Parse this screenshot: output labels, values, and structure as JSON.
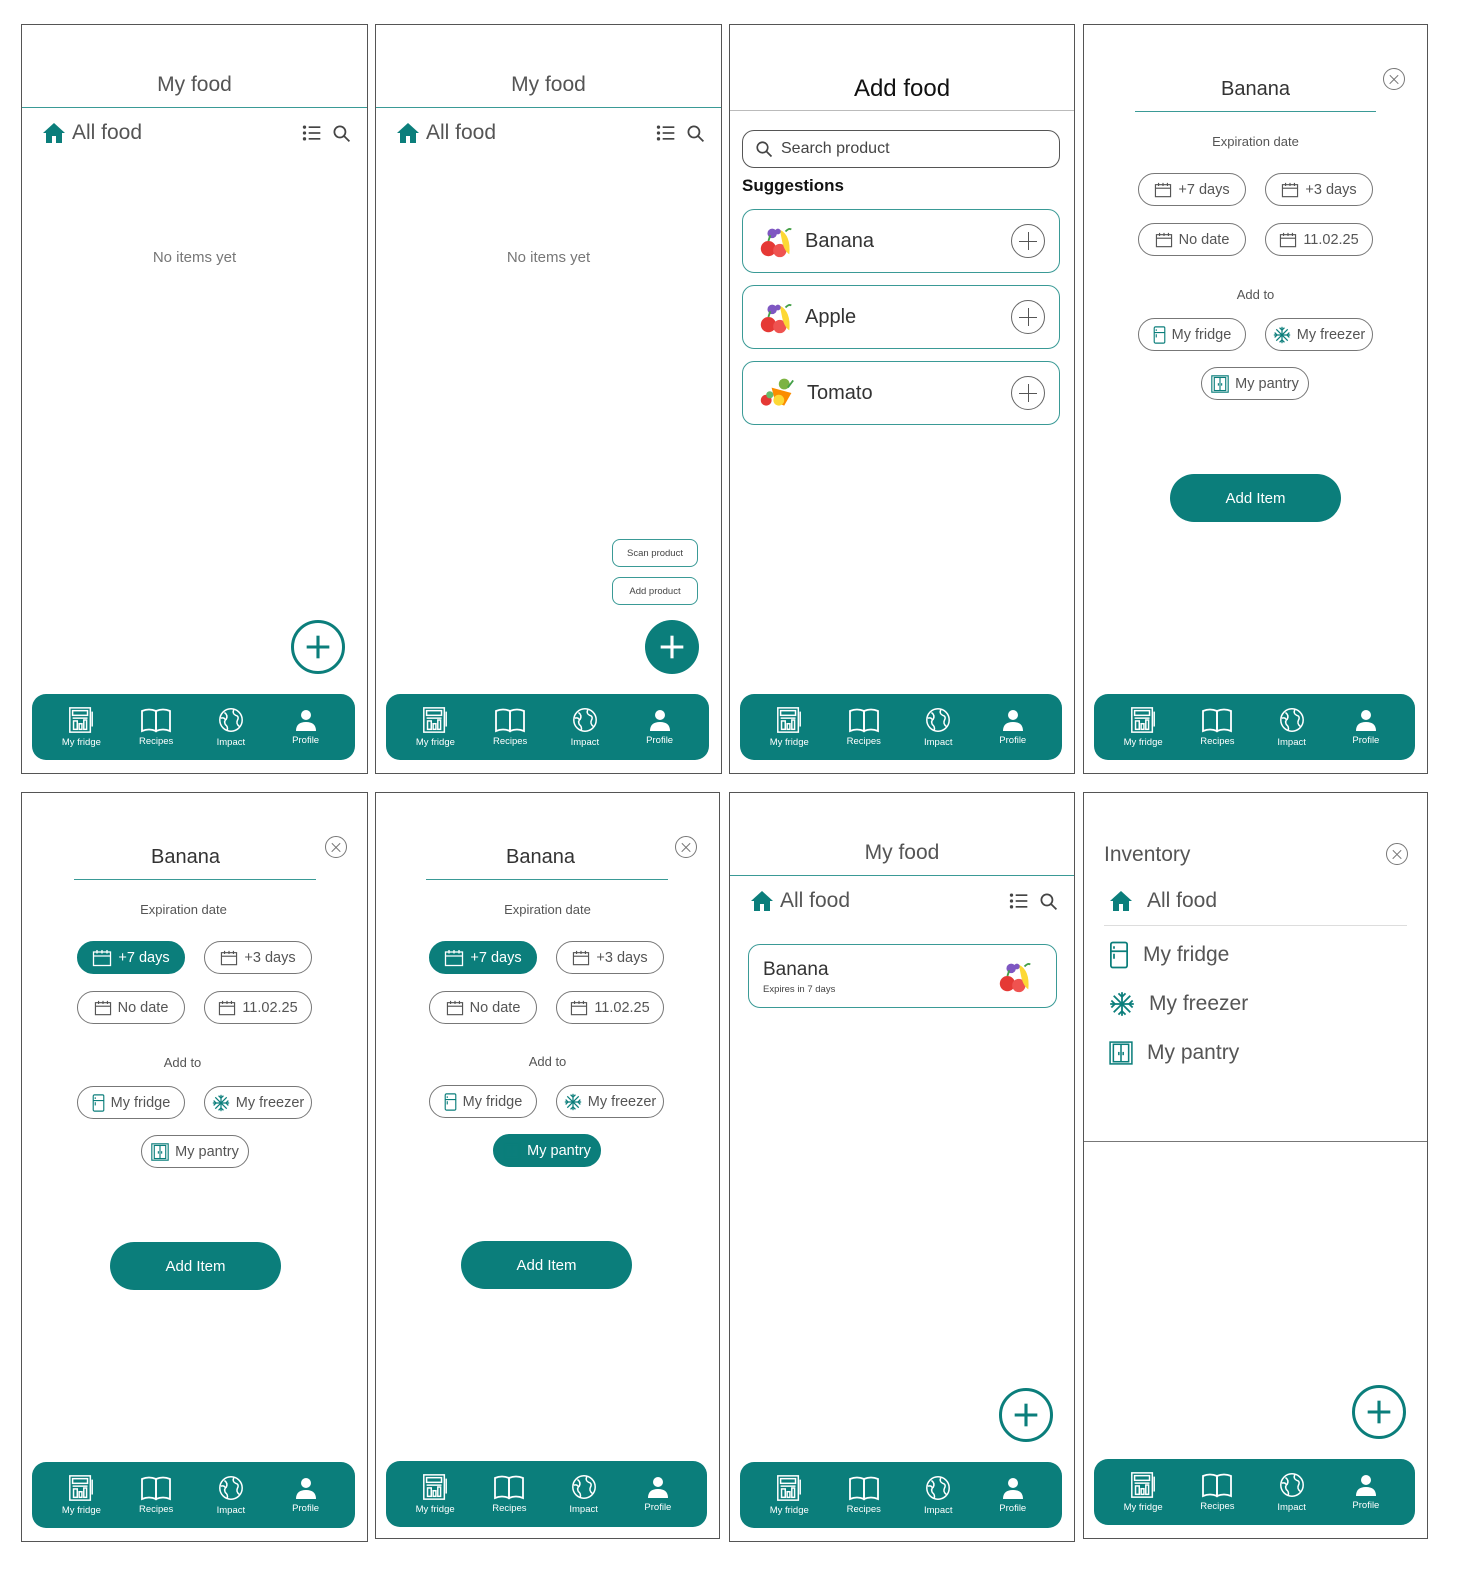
{
  "colors": {
    "accent": "#0b7e7b",
    "outline": "#3a9a96"
  },
  "my_food": {
    "title": "My food",
    "all_food": "All food",
    "empty": "No items yet"
  },
  "menu": {
    "scan": "Scan product",
    "add": "Add product"
  },
  "add_food": {
    "title": "Add food",
    "search_placeholder": "Search product",
    "suggestions_title": "Suggestions",
    "suggestions": [
      {
        "name": "Banana",
        "icon": "fruit-bowl-icon"
      },
      {
        "name": "Apple",
        "icon": "fruit-bowl-icon"
      },
      {
        "name": "Tomato",
        "icon": "vegetables-icon"
      }
    ]
  },
  "detail": {
    "title": "Banana",
    "expiration_label": "Expiration date",
    "add_to_label": "Add to",
    "dates": [
      "+7 days",
      "+3 days",
      "No date",
      "11.02.25"
    ],
    "locations": [
      "My fridge",
      "My freezer",
      "My pantry"
    ],
    "add_button": "Add Item"
  },
  "food_card": {
    "name": "Banana",
    "expires": "Expires in 7 days"
  },
  "inventory": {
    "title": "Inventory",
    "items": [
      "All food",
      "My fridge",
      "My freezer",
      "My pantry"
    ]
  },
  "nav": {
    "items": [
      {
        "label": "My fridge",
        "icon": "fridge-icon"
      },
      {
        "label": "Recipes",
        "icon": "book-icon"
      },
      {
        "label": "Impact",
        "icon": "globe-icon"
      },
      {
        "label": "Profile",
        "icon": "person-icon"
      }
    ]
  }
}
